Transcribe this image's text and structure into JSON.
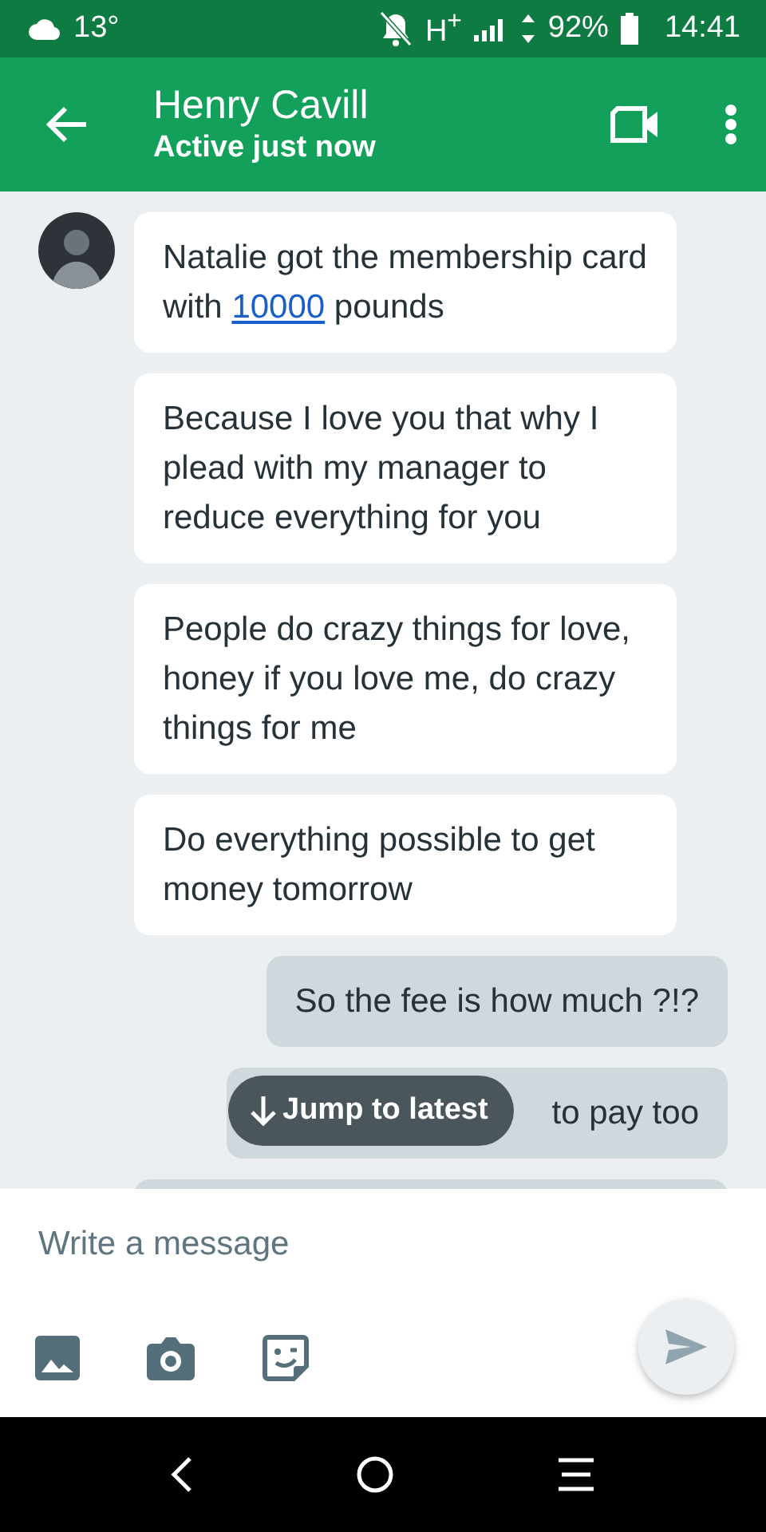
{
  "status_bar": {
    "temperature": "13°",
    "network": "H$^{+}$",
    "battery": "92%",
    "time": "14:41"
  },
  "header": {
    "title": "Henry Cavill",
    "subtitle": "Active just now"
  },
  "messages": [
    {
      "kind": "received",
      "avatar": true,
      "parts": [
        {
          "kind": "text",
          "text": "Natalie got the membership card with "
        },
        {
          "kind": "link",
          "text": "10000"
        },
        {
          "kind": "text",
          "text": " pounds"
        }
      ]
    },
    {
      "kind": "received",
      "avatar": false,
      "parts": [
        {
          "kind": "text",
          "text": "Because I love you that why I plead with my manager to reduce everything for you"
        }
      ]
    },
    {
      "kind": "received",
      "avatar": false,
      "parts": [
        {
          "kind": "text",
          "text": "People do crazy things for love, honey if you love me, do crazy things for me"
        }
      ]
    },
    {
      "kind": "received",
      "avatar": false,
      "parts": [
        {
          "kind": "text",
          "text": "Do everything possible to get money tomorrow"
        }
      ]
    },
    {
      "kind": "sent",
      "parts": [
        {
          "kind": "text",
          "text": "So the fee is how much ?!?"
        }
      ]
    },
    {
      "kind": "covered",
      "parts": [
        {
          "kind": "text",
          "text": "to pay too"
        }
      ]
    },
    {
      "kind": "partial"
    }
  ],
  "jump_button": {
    "label": "Jump to latest"
  },
  "composer": {
    "placeholder": "Write a message"
  }
}
